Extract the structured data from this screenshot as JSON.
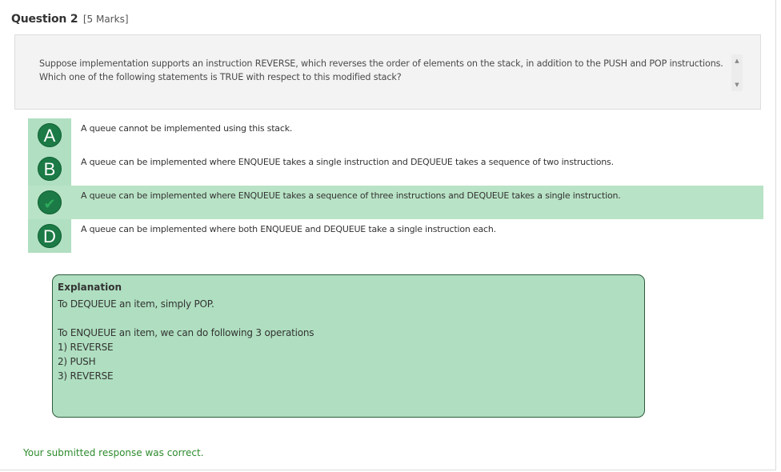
{
  "question": {
    "title": "Question 2",
    "marks": "[5 Marks]",
    "text": "Suppose implementation supports an instruction REVERSE, which reverses the order of elements on the stack, in addition to the PUSH and POP instructions. Which one of the following statements is TRUE with respect to this modified stack?"
  },
  "options": [
    {
      "letter": "A",
      "text": "A queue cannot be implemented using this stack.",
      "selected": false
    },
    {
      "letter": "B",
      "text": "A queue can be implemented where ENQUEUE takes a single instruction and DEQUEUE takes a sequence of two instructions.",
      "selected": false
    },
    {
      "letter": "C",
      "text": "A queue can be implemented where ENQUEUE takes a sequence of three instructions and DEQUEUE takes a single instruction.",
      "selected": true,
      "icon": "check-icon"
    },
    {
      "letter": "D",
      "text": "A queue can be implemented where both ENQUEUE and DEQUEUE take a single instruction each.",
      "selected": false
    }
  ],
  "explanation": {
    "title": "Explanation",
    "lines": [
      "To DEQUEUE an item, simply POP.",
      "",
      "To ENQUEUE an item, we can do following 3 operations",
      "1) REVERSE",
      "2) PUSH",
      "3) REVERSE"
    ]
  },
  "feedback": "Your submitted response was correct.",
  "colors": {
    "option_strip": "#b0dfc1",
    "selected_row": "#b9e3c6",
    "bubble": "#1b7a45",
    "explanation_bg": "#afdfc0",
    "feedback_text": "#2e8b2e"
  }
}
